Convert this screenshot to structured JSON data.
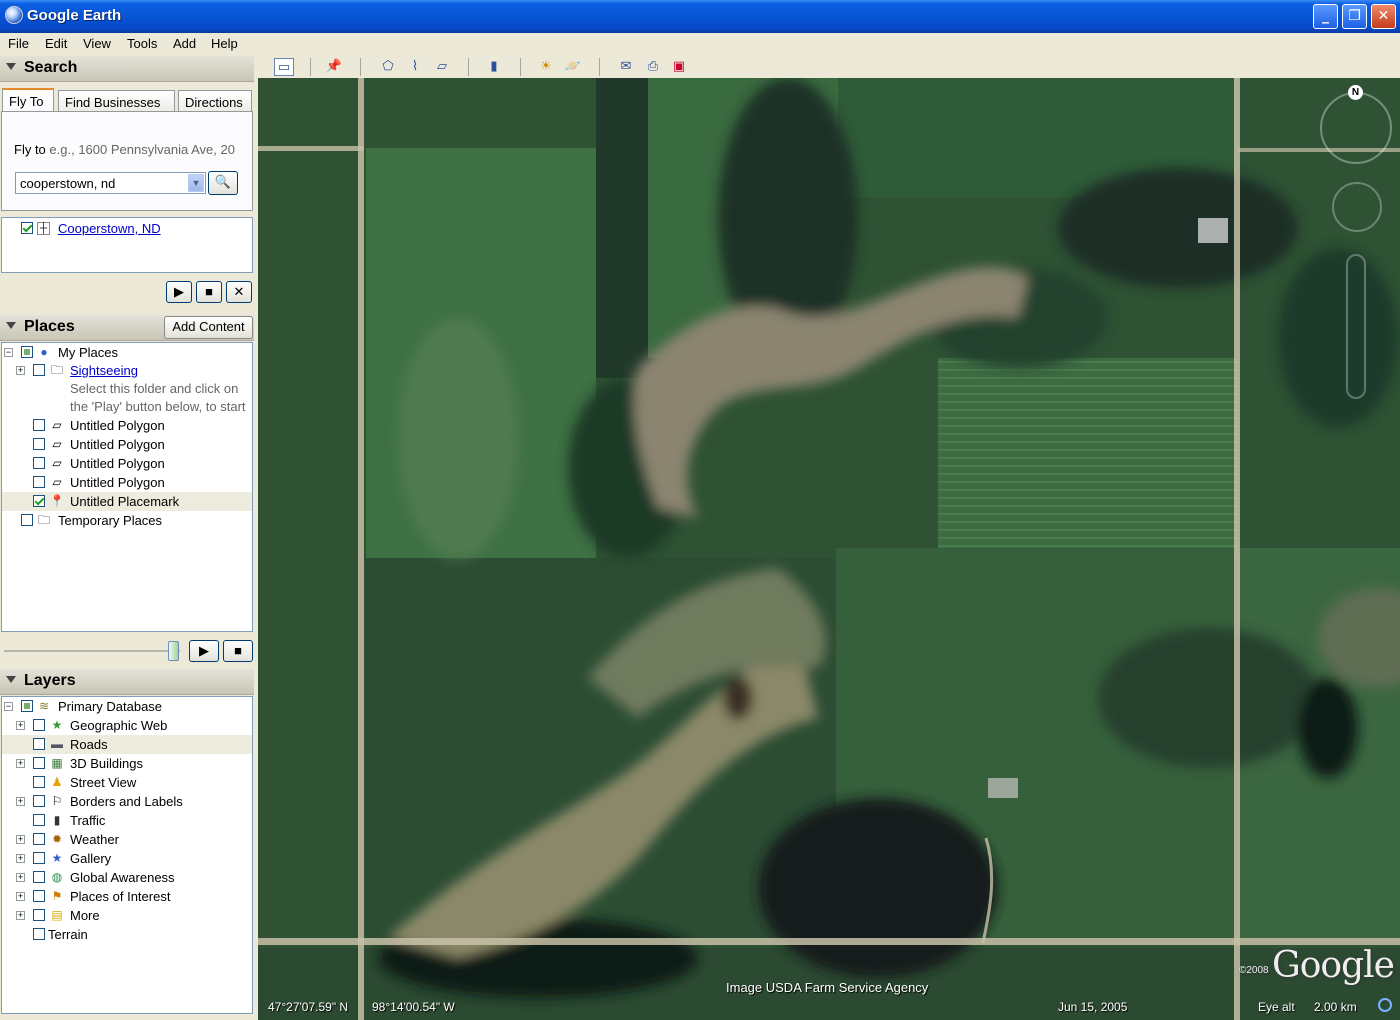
{
  "window": {
    "title": "Google Earth"
  },
  "menu": [
    "File",
    "Edit",
    "View",
    "Tools",
    "Add",
    "Help"
  ],
  "toolbar": {
    "icons": [
      "sidebar-icon",
      "placemark-icon",
      "polygon-icon",
      "path-icon",
      "image-overlay-icon",
      "ruler-icon",
      "sun-icon",
      "planets-icon",
      "email-icon",
      "print-icon",
      "view-in-maps-icon"
    ]
  },
  "search": {
    "header": "Search",
    "tabs": [
      "Fly To",
      "Find Businesses",
      "Directions"
    ],
    "fly_to_label": "Fly to",
    "fly_to_hint": "e.g., 1600 Pennsylvania Ave, 20",
    "query": "cooperstown, nd",
    "results": [
      {
        "label": "Cooperstown, ND",
        "checked": true
      }
    ]
  },
  "places": {
    "header": "Places",
    "add_content": "Add Content",
    "items": [
      {
        "label": "My Places"
      },
      {
        "label": "Sightseeing",
        "link": true
      },
      {
        "label": "Select this folder and click on"
      },
      {
        "label": "the 'Play' button below, to start"
      },
      {
        "label": "Untitled Polygon"
      },
      {
        "label": "Untitled Polygon"
      },
      {
        "label": "Untitled Polygon"
      },
      {
        "label": "Untitled Polygon"
      },
      {
        "label": "Untitled Placemark",
        "checked": true
      },
      {
        "label": "Temporary Places"
      }
    ]
  },
  "layers": {
    "header": "Layers",
    "items": [
      {
        "label": "Primary Database"
      },
      {
        "label": "Geographic Web"
      },
      {
        "label": "Roads"
      },
      {
        "label": "3D Buildings"
      },
      {
        "label": "Street View"
      },
      {
        "label": "Borders and Labels"
      },
      {
        "label": "Traffic"
      },
      {
        "label": "Weather"
      },
      {
        "label": "Gallery"
      },
      {
        "label": "Global Awareness"
      },
      {
        "label": "Places of Interest"
      },
      {
        "label": "More"
      },
      {
        "label": "Terrain"
      }
    ]
  },
  "map": {
    "credit": "Image USDA Farm Service Agency",
    "lat": "47°27'07.59\" N",
    "lon": "98°14'00.54\" W",
    "date": "Jun 15, 2005",
    "eye_alt_label": "Eye alt",
    "eye_alt": "2.00 km",
    "copyright": "©2008",
    "logo": "Google",
    "compass_north": "N"
  }
}
